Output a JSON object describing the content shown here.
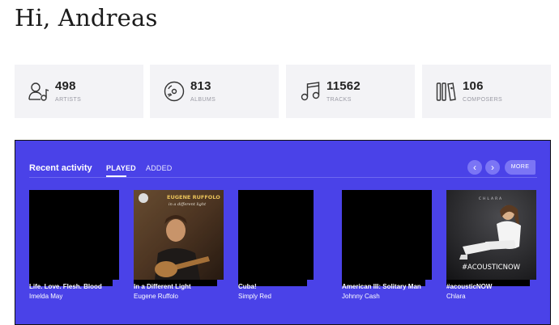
{
  "greeting": "Hi, Andreas",
  "stats": [
    {
      "icon": "artist-icon",
      "value": "498",
      "label": "ARTISTS"
    },
    {
      "icon": "album-disc-icon",
      "value": "813",
      "label": "ALBUMS"
    },
    {
      "icon": "music-note-icon",
      "value": "11562",
      "label": "TRACKS"
    },
    {
      "icon": "composer-icon",
      "value": "106",
      "label": "COMPOSERS"
    }
  ],
  "recent_activity": {
    "title": "Recent activity",
    "tabs": [
      "PLAYED",
      "ADDED"
    ],
    "active_tab": "PLAYED",
    "prev_label": "‹",
    "next_label": "›",
    "more_label": "MORE",
    "accent_color": "#4a42e8",
    "albums": [
      {
        "title": "Life. Love. Flesh. Blood",
        "artist": "Imelda May",
        "cover": "black"
      },
      {
        "title": "In a Different Light",
        "artist": "Eugene Ruffolo",
        "cover": "art",
        "cover_text": "EUGENE RUFFOLO",
        "cover_subtext": "in a different light"
      },
      {
        "title": "Cuba!",
        "artist": "Simply Red",
        "cover": "black"
      },
      {
        "title": "American III: Solitary Man",
        "artist": "Johnny Cash",
        "cover": "black"
      },
      {
        "title": "#acousticNOW",
        "artist": "Chlara",
        "cover": "art",
        "cover_text": "CHLARA",
        "cover_subtext": "#ACOUSTICNOW"
      }
    ]
  }
}
